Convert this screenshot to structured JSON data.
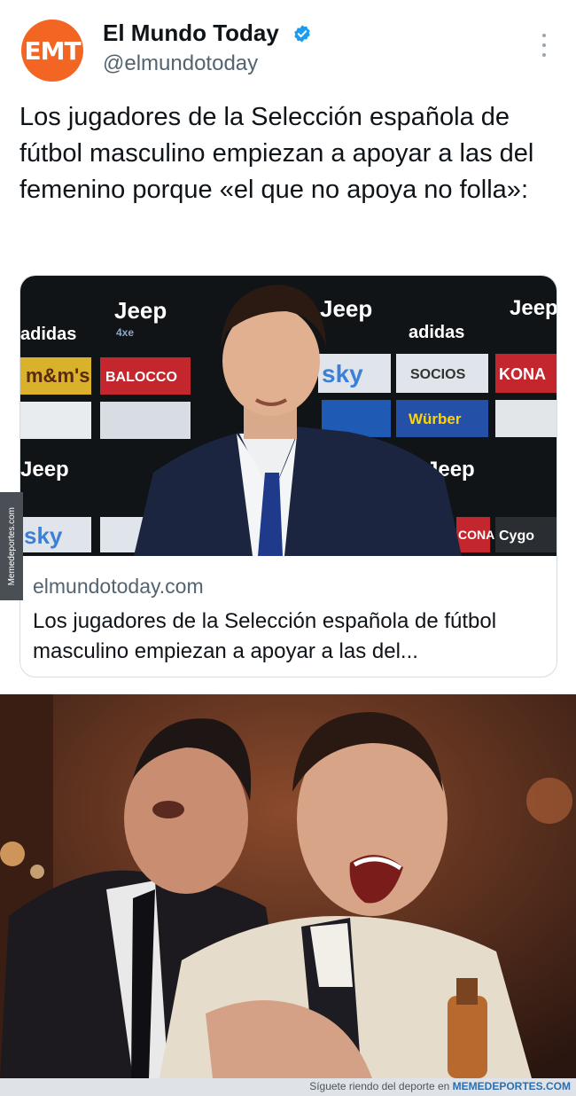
{
  "account": {
    "avatar_text": "EMT",
    "name": "El Mundo Today",
    "handle": "@elmundotoday"
  },
  "tweet": {
    "text": "Los jugadores de la Selección española de fútbol masculino empiezan a apoyar a las del femenino porque «el que no apoya no folla»:"
  },
  "card": {
    "domain": "elmundotoday.com",
    "title": "Los jugadores de la Selección española de fútbol masculino empiezan a apoyar a las del...",
    "sponsor_board": [
      "Jeep",
      "adidas",
      "m&m's",
      "BALOCCO",
      "sky",
      "SOCIOS",
      "KONA",
      "Würber",
      "CONAD",
      "Cygo"
    ]
  },
  "watermark": {
    "side": "Memedeportes.com",
    "footer_prefix": "Síguete riendo del deporte en",
    "footer_brand": "MEMEDEPORTES.COM"
  },
  "colors": {
    "avatar": "#f26522",
    "verified": "#1d9bf0",
    "backdrop": "#111417"
  }
}
